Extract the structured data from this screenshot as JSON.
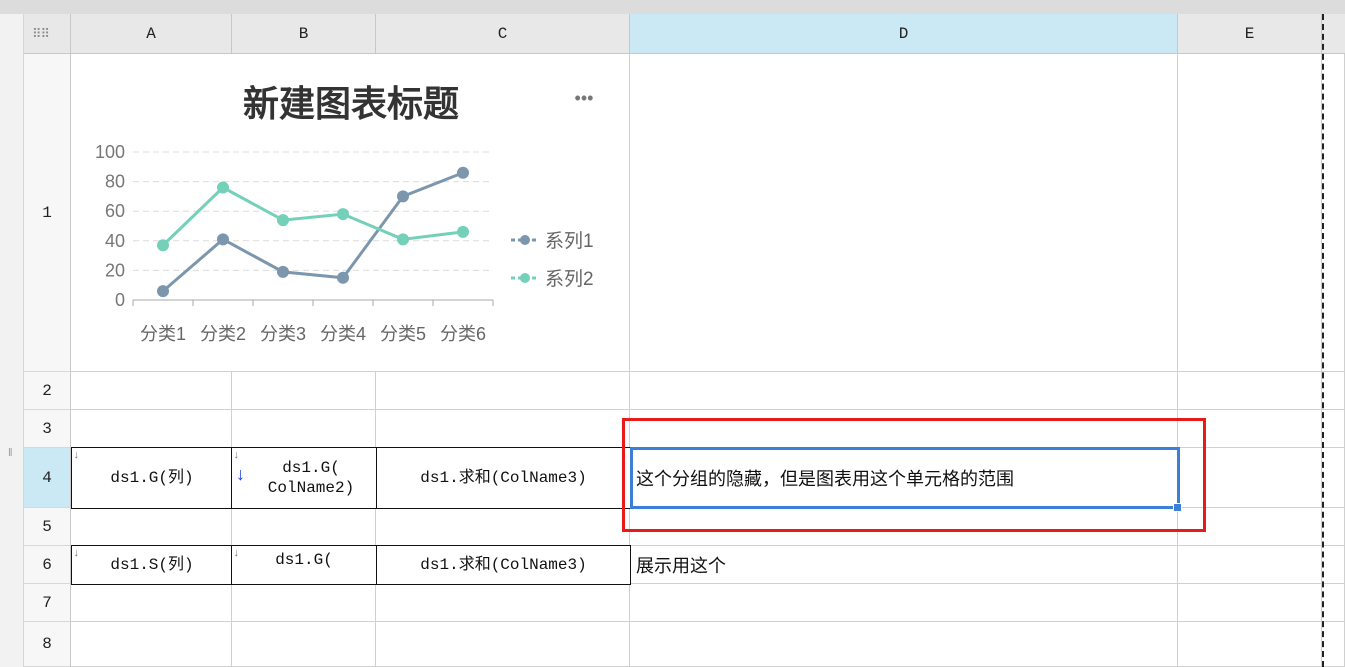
{
  "columns": [
    "A",
    "B",
    "C",
    "D",
    "E"
  ],
  "rows": [
    "1",
    "2",
    "3",
    "4",
    "5",
    "6",
    "7",
    "8"
  ],
  "cells": {
    "A4": "ds1.G(列)",
    "B4_line1": "ds1.G(",
    "B4_line2": "ColName2)",
    "C4": "ds1.求和(ColName3)",
    "D4": "这个分组的隐藏，但是图表用这个单元格的范围",
    "A6": "ds1.S(列)",
    "B6": "ds1.G(",
    "C6": "ds1.求和(ColName3)",
    "D6": "展示用这个"
  },
  "markers": {
    "expand_down": "↓",
    "blue_expand": "↓"
  },
  "chart_menu": "•••",
  "chart_data": {
    "type": "line",
    "title": "新建图表标题",
    "categories": [
      "分类1",
      "分类2",
      "分类3",
      "分类4",
      "分类5",
      "分类6"
    ],
    "series": [
      {
        "name": "系列1",
        "color": "#7b96ad",
        "values": [
          6,
          41,
          19,
          15,
          70,
          86
        ]
      },
      {
        "name": "系列2",
        "color": "#74d0b8",
        "values": [
          37,
          76,
          54,
          58,
          41,
          46
        ]
      }
    ],
    "yticks": [
      "0",
      "20",
      "40",
      "60",
      "80",
      "100"
    ],
    "ylim": [
      0,
      100
    ],
    "grid": true,
    "legend_position": "right"
  },
  "colors": {
    "selected_header": "#cbe8f5",
    "selection_border": "#3b7fd8",
    "annotation_border": "#e81b1b"
  }
}
